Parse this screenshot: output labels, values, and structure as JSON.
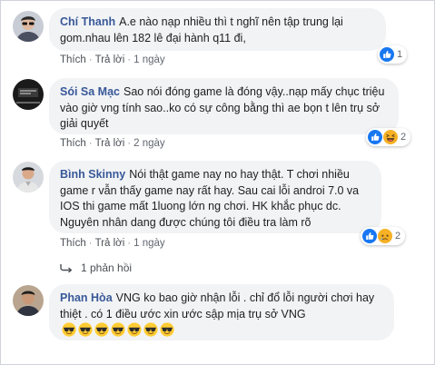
{
  "comments": [
    {
      "author": "Chí Thanh",
      "text": "A.e nào nạp nhiều thì t nghĩ nên tập trung lại gom.nhau lên 182 lê đại hành q11 đi,",
      "like_label": "Thích",
      "reply_label": "Trả lời",
      "time": "1 ngày",
      "reactions": [
        "like-icon"
      ],
      "reaction_count": "1"
    },
    {
      "author": "Sói Sa Mạc",
      "text": "Sao nói đóng game là đóng vậy..nạp mấy chục triệu vào giờ vng tính sao..ko có sự công bằng thì ae bọn t lên trụ sở giải quyết",
      "like_label": "Thích",
      "reply_label": "Trả lời",
      "time": "2 ngày",
      "reactions": [
        "like-icon",
        "haha-icon"
      ],
      "reaction_count": "2"
    },
    {
      "author": "Bình Skinny",
      "text": "Nói thật game nay no hay thật. T chơi nhiều game r vẫn thấy game nay rất hay. Sau cai lỗi androi 7.0 va IOS thi game mất 1luong lớn ng chơi. HK khắc phục dc. Nguyên nhân dang được chúng tôi điều tra làm rõ",
      "like_label": "Thích",
      "reply_label": "Trả lời",
      "time": "1 ngày",
      "reactions": [
        "like-icon",
        "sad-icon"
      ],
      "reaction_count": "2",
      "replies_label": "1 phản hồi"
    },
    {
      "author": "Phan Hòa",
      "text": "VNG ko bao giờ nhận lỗi . chỉ đổ lỗi người chơi hay thiệt . có 1 điều ước xin ước sập mịa trụ sở VNG",
      "reactions": []
    }
  ],
  "colors": {
    "author": "#385898",
    "bubble": "#f2f3f5",
    "like": "#1877f2",
    "haha": "#f7b125"
  }
}
